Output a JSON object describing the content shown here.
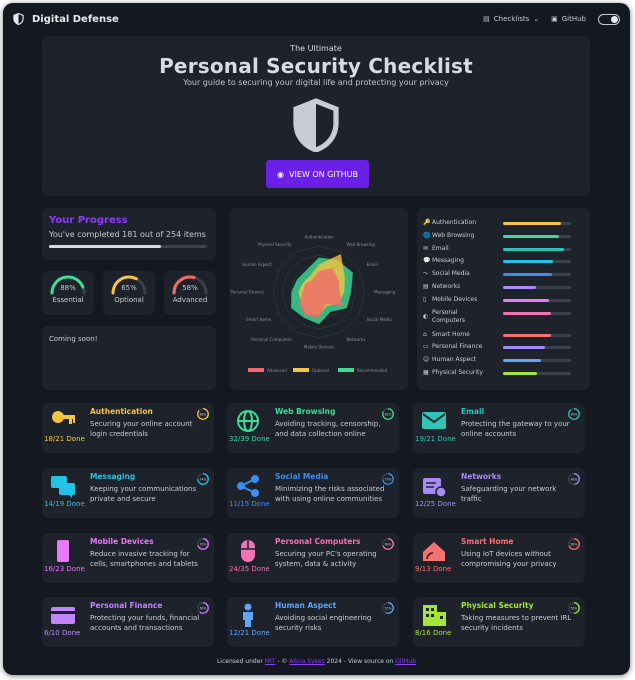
{
  "nav": {
    "brand": "Digital Defense",
    "checklists_label": "Checklists",
    "github_label": "GitHub"
  },
  "hero": {
    "pretitle": "The Ultimate",
    "title": "Personal Security Checklist",
    "subtitle": "Your guide to securing your digital life and protecting your privacy",
    "button_label": "VIEW ON GITHUB"
  },
  "progress": {
    "title": "Your Progress",
    "summary": "You've completed 181 out of 254 items",
    "fraction": 0.71
  },
  "gauges": [
    {
      "pct_label": "88%",
      "label": "Essential",
      "value": 0.88,
      "color": "#3ddc97"
    },
    {
      "pct_label": "65%",
      "label": "Optional",
      "value": 0.65,
      "color": "#f5c542"
    },
    {
      "pct_label": "58%",
      "label": "Advanced",
      "value": 0.58,
      "color": "#f26b6b"
    }
  ],
  "soon_text": "Coming soon!",
  "radar": {
    "axes": [
      "Authentication",
      "Web Browsing",
      "Email",
      "Messaging",
      "Social Media",
      "Networks",
      "Mobile Devices",
      "Personal Computers",
      "Smart Home",
      "Personal Finance",
      "Human Aspect",
      "Physical Security"
    ],
    "legend": [
      "Advanced",
      "Optional",
      "Recommended"
    ],
    "colors": [
      "#f26b6b",
      "#f5c542",
      "#3ddc97"
    ]
  },
  "category_progress": [
    {
      "label": "Authentication",
      "value": 0.86,
      "color": "#f5c542",
      "icon": "key-icon",
      "glyph": "🔑"
    },
    {
      "label": "Web Browsing",
      "value": 0.82,
      "color": "#3ddc97",
      "icon": "globe-icon",
      "glyph": "🌐"
    },
    {
      "label": "Email",
      "value": 0.9,
      "color": "#2ec4b6",
      "icon": "envelope-icon",
      "glyph": "✉"
    },
    {
      "label": "Messaging",
      "value": 0.74,
      "color": "#22c3e6",
      "icon": "chat-icon",
      "glyph": "💬"
    },
    {
      "label": "Social Media",
      "value": 0.72,
      "color": "#3b8ff0",
      "icon": "share-icon",
      "glyph": "⤳"
    },
    {
      "label": "Networks",
      "value": 0.48,
      "color": "#a78bfa",
      "icon": "router-icon",
      "glyph": "▤"
    },
    {
      "label": "Mobile Devices",
      "value": 0.68,
      "color": "#e879f9",
      "icon": "phone-icon",
      "glyph": "▯"
    },
    {
      "label": "Personal Computers",
      "value": 0.7,
      "color": "#f472b6",
      "icon": "mouse-icon",
      "glyph": "◐"
    },
    {
      "label": "Smart Home",
      "value": 0.7,
      "color": "#f87171",
      "icon": "home-icon",
      "glyph": "⌂"
    },
    {
      "label": "Personal Finance",
      "value": 0.62,
      "color": "#a78bfa",
      "icon": "card-icon",
      "glyph": "▭"
    },
    {
      "label": "Human Aspect",
      "value": 0.56,
      "color": "#60a5fa",
      "icon": "person-icon",
      "glyph": "☺"
    },
    {
      "label": "Physical Security",
      "value": 0.5,
      "color": "#a3e635",
      "icon": "building-icon",
      "glyph": "▦"
    }
  ],
  "sections": [
    {
      "title": "Authentication",
      "desc": "Securing your online account login credentials",
      "done": "18/21 Done",
      "ring_label": "86%",
      "ring": 0.86,
      "color": "#f5c542",
      "icon": "key-icon"
    },
    {
      "title": "Web Browsing",
      "desc": "Avoiding tracking, censorship, and data collection online",
      "done": "32/39 Done",
      "ring_label": "82%",
      "ring": 0.82,
      "color": "#3ddc97",
      "icon": "globe-icon"
    },
    {
      "title": "Email",
      "desc": "Protecting the gateway to your online accounts",
      "done": "19/21 Done",
      "ring_label": "90%",
      "ring": 0.9,
      "color": "#2ec4b6",
      "icon": "envelope-icon"
    },
    {
      "title": "Messaging",
      "desc": "Keeping your communications private and secure",
      "done": "14/19 Done",
      "ring_label": "74%",
      "ring": 0.74,
      "color": "#22c3e6",
      "icon": "chat-icon"
    },
    {
      "title": "Social Media",
      "desc": "Minimizing the risks associated with using online communities",
      "done": "11/15 Done",
      "ring_label": "73%",
      "ring": 0.73,
      "color": "#3b8ff0",
      "icon": "share-icon"
    },
    {
      "title": "Networks",
      "desc": "Safeguarding your network traffic",
      "done": "12/25 Done",
      "ring_label": "48%",
      "ring": 0.48,
      "color": "#a78bfa",
      "icon": "router-icon"
    },
    {
      "title": "Mobile Devices",
      "desc": "Reduce invasive tracking for cells, smartphones and tablets",
      "done": "16/23 Done",
      "ring_label": "70%",
      "ring": 0.7,
      "color": "#e879f9",
      "icon": "phone-icon"
    },
    {
      "title": "Personal Computers",
      "desc": "Securing your PC's operating system, data & activity",
      "done": "24/35 Done",
      "ring_label": "69%",
      "ring": 0.69,
      "color": "#f472b6",
      "icon": "mouse-icon"
    },
    {
      "title": "Smart Home",
      "desc": "Using IoT devices without compromising your privacy",
      "done": "9/13 Done",
      "ring_label": "69%",
      "ring": 0.69,
      "color": "#f87171",
      "icon": "home-icon"
    },
    {
      "title": "Personal Finance",
      "desc": "Protecting your funds, financial accounts and transactions",
      "done": "6/10 Done",
      "ring_label": "60%",
      "ring": 0.6,
      "color": "#c084fc",
      "icon": "card-icon"
    },
    {
      "title": "Human Aspect",
      "desc": "Avoiding social engineering security risks",
      "done": "12/21 Done",
      "ring_label": "57%",
      "ring": 0.57,
      "color": "#60a5fa",
      "icon": "person-icon"
    },
    {
      "title": "Physical Security",
      "desc": "Taking measures to prevent IRL security incidents",
      "done": "8/16 Done",
      "ring_label": "50%",
      "ring": 0.5,
      "color": "#a3e635",
      "icon": "building-icon"
    }
  ],
  "footer": {
    "pre": "Licensed under ",
    "license": "MIT",
    "mid": " - © ",
    "author": "Alicia Sykes",
    "year": " 2024 - View source on ",
    "source": "GitHub"
  }
}
